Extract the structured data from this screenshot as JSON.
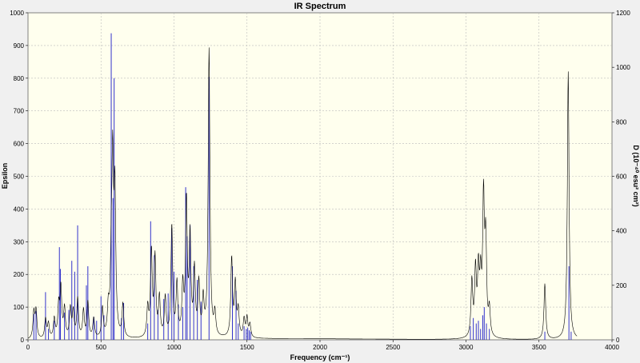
{
  "chart_data": {
    "type": "line",
    "title": "IR Spectrum",
    "xlabel": "Frequency (cm⁻¹)",
    "ylabel": "Epsilon",
    "y2label": "D (10⁻⁴⁰ esu² cm²)",
    "xlim": [
      0,
      4000
    ],
    "ylim": [
      0,
      1000
    ],
    "y2lim": [
      0,
      1200
    ],
    "xticks": [
      0,
      500,
      1000,
      1500,
      2000,
      2500,
      3000,
      3500,
      4000
    ],
    "yticks": [
      0,
      100,
      200,
      300,
      400,
      500,
      600,
      700,
      800,
      900,
      1000
    ],
    "y2ticks": [
      0,
      200,
      400,
      600,
      800,
      1000,
      1200
    ],
    "grid": true,
    "colors": {
      "spectrum": "#000000",
      "sticks": "#3333cc",
      "background": "#ffffee",
      "grid": "#bbbbbb"
    },
    "peaks": [
      {
        "x": 40,
        "eps": 80
      },
      {
        "x": 55,
        "eps": 85
      },
      {
        "x": 120,
        "eps": 60
      },
      {
        "x": 140,
        "eps": 45
      },
      {
        "x": 180,
        "eps": 60
      },
      {
        "x": 210,
        "eps": 95
      },
      {
        "x": 225,
        "eps": 150
      },
      {
        "x": 250,
        "eps": 90
      },
      {
        "x": 290,
        "eps": 90
      },
      {
        "x": 310,
        "eps": 80
      },
      {
        "x": 340,
        "eps": 120
      },
      {
        "x": 380,
        "eps": 85
      },
      {
        "x": 410,
        "eps": 110
      },
      {
        "x": 450,
        "eps": 60
      },
      {
        "x": 510,
        "eps": 90
      },
      {
        "x": 550,
        "eps": 80
      },
      {
        "x": 570,
        "eps": 180
      },
      {
        "x": 580,
        "eps": 500
      },
      {
        "x": 595,
        "eps": 420
      },
      {
        "x": 650,
        "eps": 100
      },
      {
        "x": 820,
        "eps": 90
      },
      {
        "x": 845,
        "eps": 260
      },
      {
        "x": 870,
        "eps": 240
      },
      {
        "x": 900,
        "eps": 120
      },
      {
        "x": 940,
        "eps": 120
      },
      {
        "x": 985,
        "eps": 340
      },
      {
        "x": 1020,
        "eps": 160
      },
      {
        "x": 1060,
        "eps": 150
      },
      {
        "x": 1085,
        "eps": 410
      },
      {
        "x": 1110,
        "eps": 300
      },
      {
        "x": 1140,
        "eps": 200
      },
      {
        "x": 1170,
        "eps": 160
      },
      {
        "x": 1200,
        "eps": 110
      },
      {
        "x": 1240,
        "eps": 880
      },
      {
        "x": 1280,
        "eps": 70
      },
      {
        "x": 1395,
        "eps": 240
      },
      {
        "x": 1420,
        "eps": 160
      },
      {
        "x": 1440,
        "eps": 80
      },
      {
        "x": 1480,
        "eps": 55
      },
      {
        "x": 1500,
        "eps": 60
      },
      {
        "x": 1520,
        "eps": 40
      },
      {
        "x": 3040,
        "eps": 170
      },
      {
        "x": 3065,
        "eps": 200
      },
      {
        "x": 3085,
        "eps": 190
      },
      {
        "x": 3100,
        "eps": 160
      },
      {
        "x": 3120,
        "eps": 410
      },
      {
        "x": 3135,
        "eps": 280
      },
      {
        "x": 3160,
        "eps": 80
      },
      {
        "x": 3540,
        "eps": 170
      },
      {
        "x": 3700,
        "eps": 820
      }
    ],
    "sticks": [
      {
        "x": 40,
        "d": 95
      },
      {
        "x": 55,
        "d": 105
      },
      {
        "x": 120,
        "d": 175
      },
      {
        "x": 140,
        "d": 40
      },
      {
        "x": 180,
        "d": 70
      },
      {
        "x": 215,
        "d": 340
      },
      {
        "x": 222,
        "d": 260
      },
      {
        "x": 250,
        "d": 100
      },
      {
        "x": 280,
        "d": 110
      },
      {
        "x": 300,
        "d": 290
      },
      {
        "x": 320,
        "d": 250
      },
      {
        "x": 340,
        "d": 420
      },
      {
        "x": 400,
        "d": 200
      },
      {
        "x": 410,
        "d": 270
      },
      {
        "x": 450,
        "d": 85
      },
      {
        "x": 470,
        "d": 70
      },
      {
        "x": 500,
        "d": 160
      },
      {
        "x": 520,
        "d": 90
      },
      {
        "x": 570,
        "d": 1125
      },
      {
        "x": 582,
        "d": 520
      },
      {
        "x": 590,
        "d": 960
      },
      {
        "x": 640,
        "d": 80
      },
      {
        "x": 655,
        "d": 135
      },
      {
        "x": 820,
        "d": 60
      },
      {
        "x": 840,
        "d": 435
      },
      {
        "x": 865,
        "d": 310
      },
      {
        "x": 890,
        "d": 110
      },
      {
        "x": 930,
        "d": 150
      },
      {
        "x": 960,
        "d": 170
      },
      {
        "x": 985,
        "d": 410
      },
      {
        "x": 1000,
        "d": 250
      },
      {
        "x": 1030,
        "d": 130
      },
      {
        "x": 1060,
        "d": 120
      },
      {
        "x": 1080,
        "d": 560
      },
      {
        "x": 1090,
        "d": 380
      },
      {
        "x": 1110,
        "d": 420
      },
      {
        "x": 1135,
        "d": 270
      },
      {
        "x": 1160,
        "d": 220
      },
      {
        "x": 1185,
        "d": 140
      },
      {
        "x": 1240,
        "d": 965
      },
      {
        "x": 1400,
        "d": 270
      },
      {
        "x": 1425,
        "d": 180
      },
      {
        "x": 1440,
        "d": 60
      },
      {
        "x": 1480,
        "d": 50
      },
      {
        "x": 1495,
        "d": 40
      },
      {
        "x": 1505,
        "d": 45
      },
      {
        "x": 1515,
        "d": 35
      },
      {
        "x": 1525,
        "d": 30
      },
      {
        "x": 3030,
        "d": 50
      },
      {
        "x": 3050,
        "d": 80
      },
      {
        "x": 3070,
        "d": 60
      },
      {
        "x": 3085,
        "d": 70
      },
      {
        "x": 3100,
        "d": 40
      },
      {
        "x": 3115,
        "d": 90
      },
      {
        "x": 3125,
        "d": 120
      },
      {
        "x": 3140,
        "d": 60
      },
      {
        "x": 3160,
        "d": 40
      },
      {
        "x": 3540,
        "d": 30
      },
      {
        "x": 3705,
        "d": 270
      },
      {
        "x": 3720,
        "d": 30
      }
    ]
  }
}
